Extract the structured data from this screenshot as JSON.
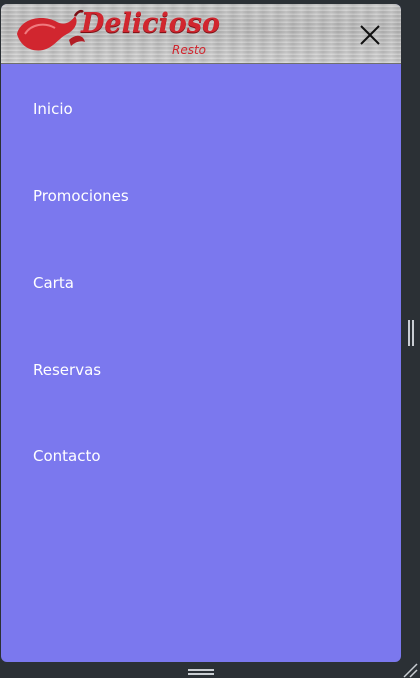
{
  "brand": {
    "name": "Delicioso",
    "tagline": "Resto",
    "accent_color": "#d1262f",
    "header_bg": "#c4c4c4"
  },
  "header": {
    "close_icon": "close-icon"
  },
  "menu": {
    "bg_color": "#7b78ee",
    "text_color": "#ffffff",
    "items": [
      {
        "label": "Inicio"
      },
      {
        "label": "Promociones"
      },
      {
        "label": "Carta"
      },
      {
        "label": "Reservas"
      },
      {
        "label": "Contacto"
      }
    ]
  },
  "window": {
    "side_handle_icon": "drag-handle-vertical-icon",
    "bottom_handle_icon": "drag-handle-horizontal-icon",
    "resize_icon": "resize-grip-icon"
  }
}
